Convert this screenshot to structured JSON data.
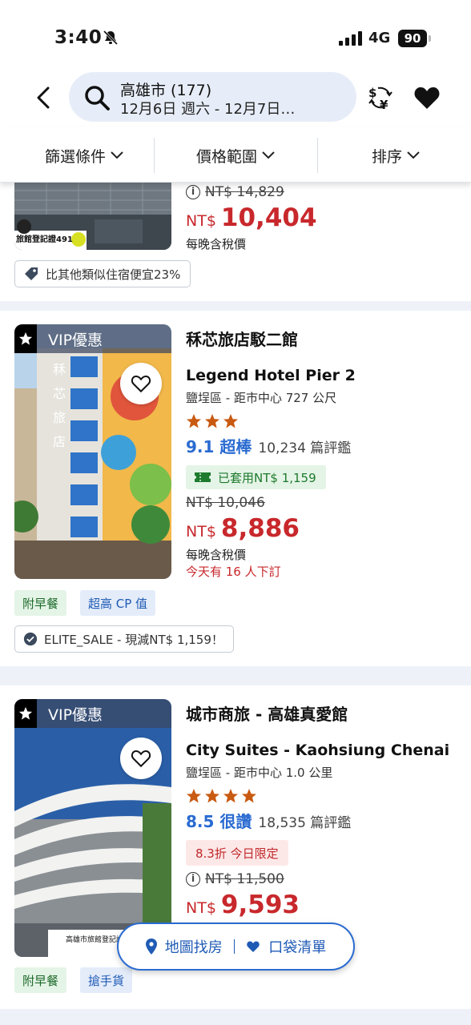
{
  "status_bar": {
    "time": "3:40",
    "network": "4G",
    "battery": "90"
  },
  "header": {
    "search_title": "高雄市 (177)",
    "search_dates": "12月6日 週六 - 12月7日…"
  },
  "filters": [
    "篩選條件",
    "價格範圍",
    "排序"
  ],
  "hotel0": {
    "old_price": "NT$ 14,829",
    "currency": "NT$",
    "price": "10,404",
    "tax_note": "每晚含稅價",
    "deal_badge": "比其他類似住宿便宜23%",
    "img_caption": "旅館登記證491"
  },
  "hotel1": {
    "vip": "VIP優惠",
    "name_zh": "秝芯旅店駁二館",
    "name_en": "Legend Hotel Pier 2",
    "location": "鹽埕區 - 距市中心 727 公尺",
    "stars": 3,
    "score": "9.1 超棒",
    "reviews": "10,234 篇評鑑",
    "coupon": "已套用NT$ 1,159",
    "old_price": "NT$ 10,046",
    "currency": "NT$",
    "price": "8,886",
    "tax_note": "每晚含稅價",
    "booked_today": "今天有 16 人下訂",
    "chips": [
      "附早餐",
      "超高 CP 值"
    ],
    "promo": "ELITE_SALE - 現減NT$ 1,159！"
  },
  "hotel2": {
    "vip": "VIP優惠",
    "name_zh": "城市商旅 - 高雄真愛館",
    "name_en": "City Suites - Kaohsiung Chenai",
    "location": "鹽埕區 - 距市中心 1.0 公里",
    "stars": 4,
    "score": "8.5 很讚",
    "reviews": "18,535 篇評鑑",
    "discount": "8.3折 今日限定",
    "old_price": "NT$ 11,500",
    "currency": "NT$",
    "price": "9,593",
    "chips": [
      "附早餐",
      "搶手貨"
    ],
    "img_caption": "高雄市旅館登記證"
  },
  "float_bar": {
    "map": "地圖找房",
    "pocket": "口袋清單"
  },
  "colors": {
    "price_red": "#c8282c",
    "link_blue": "#2a6bd1",
    "star_orange": "#c95a12"
  }
}
